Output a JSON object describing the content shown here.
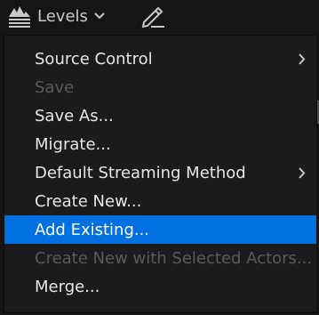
{
  "toolbar": {
    "levels_label": "Levels"
  },
  "menu": {
    "items": [
      {
        "label": "Source Control",
        "submenu": true,
        "enabled": true
      },
      {
        "label": "Save",
        "enabled": false
      },
      {
        "label": "Save As...",
        "enabled": true
      },
      {
        "label": "Migrate...",
        "enabled": true
      },
      {
        "label": "Default Streaming Method",
        "submenu": true,
        "enabled": true
      },
      {
        "label": "Create New...",
        "enabled": true
      },
      {
        "label": "Add Existing...",
        "enabled": true,
        "highlighted": true
      },
      {
        "label": "Create New with Selected Actors...",
        "enabled": false
      },
      {
        "label": "Merge...",
        "enabled": true
      }
    ]
  },
  "colors": {
    "highlight": "#0070e0",
    "menu_bg": "#1b1b1b",
    "disabled_text": "#5a5a5a"
  }
}
